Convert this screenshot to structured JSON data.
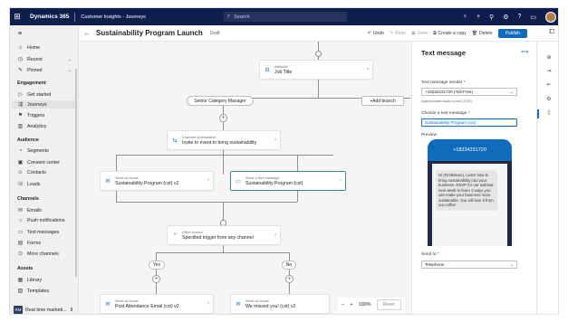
{
  "topbar": {
    "brand": "Dynamics 365",
    "app_name": "Customer Insights - Journeys",
    "search_placeholder": "Search",
    "icons": [
      "lightbulb-icon",
      "plus-icon",
      "filter-icon",
      "settings-icon",
      "help-icon",
      "chat-icon",
      "avatar"
    ]
  },
  "nav": {
    "top_items": [
      {
        "label": "Home",
        "icon": "home-icon"
      },
      {
        "label": "Recent",
        "icon": "clock-icon"
      },
      {
        "label": "Pinned",
        "icon": "pin-icon"
      }
    ],
    "groups": [
      {
        "title": "Engagement",
        "items": [
          {
            "label": "Get started",
            "icon": "play-icon"
          },
          {
            "label": "Journeys",
            "icon": "journey-icon"
          },
          {
            "label": "Triggers",
            "icon": "trigger-icon"
          },
          {
            "label": "Analytics",
            "icon": "analytics-icon"
          }
        ]
      },
      {
        "title": "Audience",
        "items": [
          {
            "label": "Segments",
            "icon": "segments-icon"
          },
          {
            "label": "Consent center",
            "icon": "consent-icon"
          },
          {
            "label": "Contacts",
            "icon": "contact-icon"
          },
          {
            "label": "Leads",
            "icon": "leads-icon"
          }
        ]
      },
      {
        "title": "Channels",
        "items": [
          {
            "label": "Emails",
            "icon": "mail-icon"
          },
          {
            "label": "Push notifications",
            "icon": "push-icon"
          },
          {
            "label": "Text messages",
            "icon": "sms-icon"
          },
          {
            "label": "Forms",
            "icon": "forms-icon"
          },
          {
            "label": "More channels",
            "icon": "more-channels-icon"
          }
        ]
      },
      {
        "title": "Assets",
        "items": [
          {
            "label": "Library",
            "icon": "library-icon"
          },
          {
            "label": "Templates",
            "icon": "templates-icon"
          }
        ]
      }
    ],
    "area_badge": "RM",
    "area_label": "Real time marketi..."
  },
  "cmdbar": {
    "title": "Sustainability Program Launch",
    "status": "Draft",
    "undo": "Undo",
    "redo": "Redo",
    "save": "Save",
    "create_copy": "Create a copy",
    "delete": "Delete",
    "publish": "Publish"
  },
  "canvas": {
    "attribute_node": {
      "label": "Attribute",
      "value": "Job Title"
    },
    "branch_pill": "Senior Category Manager",
    "add_branch": "Add branch",
    "channel_node": {
      "label": "Channel optimization",
      "value": "Invite to event to bring sustainability"
    },
    "email_node_1": {
      "label": "Send an email",
      "value": "Sustainability Program (cxt) v2"
    },
    "sms_node": {
      "label": "Send a text message",
      "value": "Sustainability Program (cxt)"
    },
    "other_branch_node": {
      "label": "Other branch",
      "value": "Specified trigger from any channel"
    },
    "yes_pill": "Yes",
    "no_pill": "No",
    "email_node_2": {
      "label": "Send an email",
      "value": "Post Attendance Email (cxt) v2"
    },
    "email_node_3": {
      "label": "Send an email",
      "value": "We missed you! (cxt) v2"
    },
    "zoom": {
      "minus": "−",
      "plus": "+",
      "level": "100%",
      "reset": "Reset"
    }
  },
  "panel": {
    "title": "Text message",
    "sender_label": "Text message sender",
    "sender_value": "+18334231720 (Toll-Free)",
    "sender_hint": "Approximate audio count (1/10)",
    "choose_label": "Choose a text message",
    "choose_value": "Sustainability Program (cxt)",
    "preview_label": "Preview",
    "phone_number": "+18334231720",
    "preview_text": "Hi {FirstName}, Learn how to bring sustainability into your business. RSVP for our webinar next week to learn 3 ways you can make your business more sustainable. You will love it from our coffee",
    "send_to_label": "Send to",
    "send_to_value": "Telephone"
  },
  "rail": {
    "icons": [
      "collapse-icon",
      "entry-icon",
      "exit-icon",
      "settings-icon",
      "properties-icon"
    ]
  }
}
